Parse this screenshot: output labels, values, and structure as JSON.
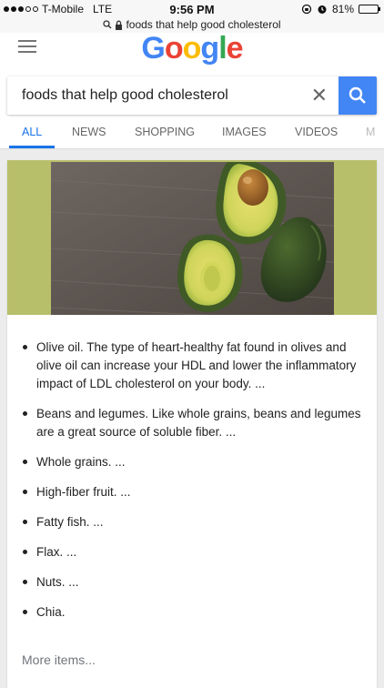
{
  "status": {
    "carrier": "T-Mobile",
    "network": "LTE",
    "time": "9:56 PM",
    "battery": "81%",
    "battery_level": 0.81
  },
  "url": {
    "lock_icon": "lock-icon",
    "text": "foods that help good cholesterol"
  },
  "header": {
    "logo_letters": [
      "G",
      "o",
      "o",
      "g",
      "l",
      "e"
    ]
  },
  "search": {
    "query": "foods that help good cholesterol",
    "clear_icon": "close-icon",
    "button_icon": "search-icon",
    "button_color": "#4285f4"
  },
  "tabs": [
    {
      "label": "ALL",
      "active": true
    },
    {
      "label": "NEWS"
    },
    {
      "label": "SHOPPING"
    },
    {
      "label": "IMAGES"
    },
    {
      "label": "VIDEOS"
    },
    {
      "label": "M"
    }
  ],
  "result": {
    "items": [
      "Olive oil. The type of heart-healthy fat found in olives and olive oil can increase your HDL and lower the inflammatory impact of LDL cholesterol on your body. ...",
      "Beans and legumes. Like whole grains, beans and legumes are a great source of soluble fiber. ...",
      "Whole grains. ...",
      "High-fiber fruit. ...",
      "Fatty fish. ...",
      "Flax. ...",
      "Nuts. ...",
      "Chia."
    ],
    "more": "More items..."
  }
}
